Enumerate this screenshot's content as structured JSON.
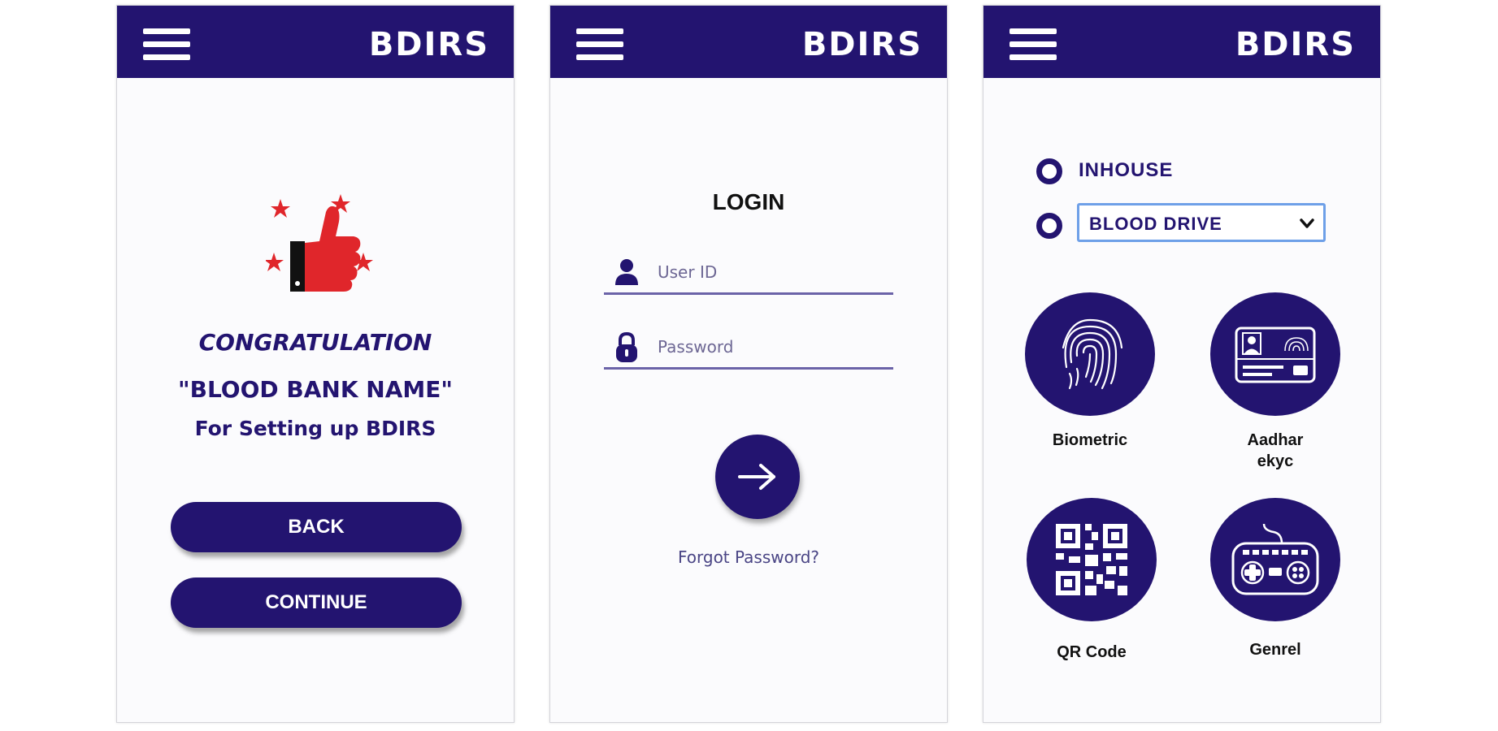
{
  "brand": "BDIRS",
  "screen1": {
    "title": "CONGRATULATION",
    "bank_name": "\"BLOOD BANK NAME\"",
    "subtitle": "For Setting up BDIRS",
    "back_label": "BACK",
    "continue_label": "CONTINUE"
  },
  "screen2": {
    "title": "LOGIN",
    "userid_placeholder": "User ID",
    "password_placeholder": "Password",
    "forgot_label": "Forgot Password?"
  },
  "screen3": {
    "inhouse_label": "INHOUSE",
    "drive_selected": "BLOOD DRIVE",
    "options": [
      {
        "label": "Biometric",
        "icon": "fingerprint-icon"
      },
      {
        "label": "Aadhar\nekyc",
        "icon": "id-card-icon"
      },
      {
        "label": "QR Code",
        "icon": "qr-code-icon"
      },
      {
        "label": "Genrel",
        "icon": "keyboard-icon"
      }
    ]
  },
  "colors": {
    "primary": "#231470",
    "accent_red": "#e0262b",
    "select_border": "#6ea0e8"
  }
}
